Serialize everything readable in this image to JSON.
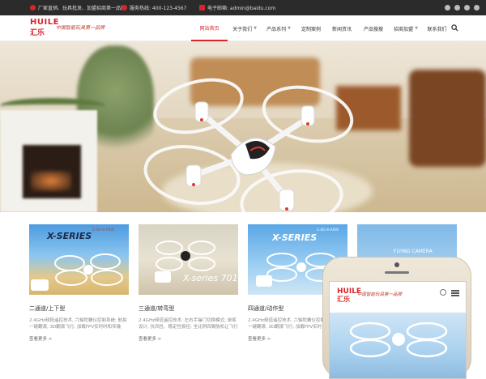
{
  "topbar": {
    "welcome": "厂家直销、玩具批发、加盟招商第一品牌",
    "hotline": "服务热线: 400-123-4567",
    "email": "电子邮箱: admin@baidu.com"
  },
  "brand": {
    "logo_line1": "HUILE",
    "logo_line2": "汇乐",
    "slogan": "中国智能玩具第一品牌"
  },
  "nav": {
    "items": [
      {
        "label": "网站首页",
        "active": true,
        "dropdown": false
      },
      {
        "label": "关于我们",
        "active": false,
        "dropdown": true
      },
      {
        "label": "产品系列",
        "active": false,
        "dropdown": true
      },
      {
        "label": "定制案例",
        "active": false,
        "dropdown": false
      },
      {
        "label": "新闻资讯",
        "active": false,
        "dropdown": false
      },
      {
        "label": "产品搜搜",
        "active": false,
        "dropdown": false
      },
      {
        "label": "招商加盟",
        "active": false,
        "dropdown": true
      },
      {
        "label": "联系我们",
        "active": false,
        "dropdown": false
      }
    ]
  },
  "products": [
    {
      "badge": "X-SERIES",
      "badge_sub": "2.4G·4-AXIS",
      "title": "二通道/上下型",
      "desc": "2.4GHz频段遥控技术, 六轴陀螺仪控制系统; 航拍一键翻滚, 3D翻滚飞行; 加载FPV实时时和传输",
      "more": "查看更多 >"
    },
    {
      "badge": "X-series 701",
      "badge_sub": "",
      "title": "三通道/转弯型",
      "desc": "2.4GHz频道遥控技术; 左右手操门切换模式; 单桨设计, 抗风性、稳定性极佳; 全比例四翼航机让飞行更加稳定",
      "more": "查看更多 >"
    },
    {
      "badge": "X-SERIES",
      "badge_sub": "2.4G·4-AXIS",
      "title": "四通道/动作型",
      "desc": "2.4GHz频道遥控技术, 六轴陀螺仪控制系统; 航拍一键翻滚, 3D翻滚飞行; 加载FPV实时",
      "more": "查看更多 >"
    },
    {
      "badge": "FLYING CAMERA",
      "badge_sub": "",
      "title": "",
      "desc": "",
      "more": ""
    }
  ],
  "colors": {
    "accent": "#d6262b",
    "topbar": "#2b2b2b"
  }
}
